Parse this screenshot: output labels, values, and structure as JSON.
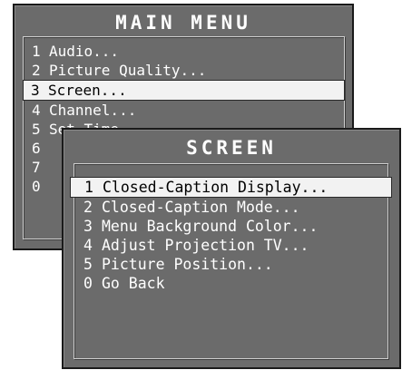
{
  "main_menu": {
    "title": "MAIN MENU",
    "items": [
      {
        "num": "1",
        "label": "Audio..."
      },
      {
        "num": "2",
        "label": "Picture Quality..."
      },
      {
        "num": "3",
        "label": "Screen...",
        "selected": true
      },
      {
        "num": "4",
        "label": "Channel..."
      },
      {
        "num": "5",
        "label": "Set Time..."
      },
      {
        "num": "6",
        "label": ""
      },
      {
        "num": "7",
        "label": ""
      },
      {
        "num": "0",
        "label": ""
      }
    ]
  },
  "screen_menu": {
    "title": "SCREEN",
    "items": [
      {
        "num": "1",
        "label": "Closed-Caption Display...",
        "selected": true
      },
      {
        "num": "2",
        "label": "Closed-Caption Mode..."
      },
      {
        "num": "3",
        "label": "Menu Background Color..."
      },
      {
        "num": "4",
        "label": "Adjust Projection TV..."
      },
      {
        "num": "5",
        "label": "Picture Position..."
      },
      {
        "num": "0",
        "label": "Go Back"
      }
    ]
  },
  "colors": {
    "window_bg": "#6b6b6b",
    "text": "#ffffff",
    "highlight_bg": "#f2f2f2",
    "highlight_text": "#000000"
  }
}
